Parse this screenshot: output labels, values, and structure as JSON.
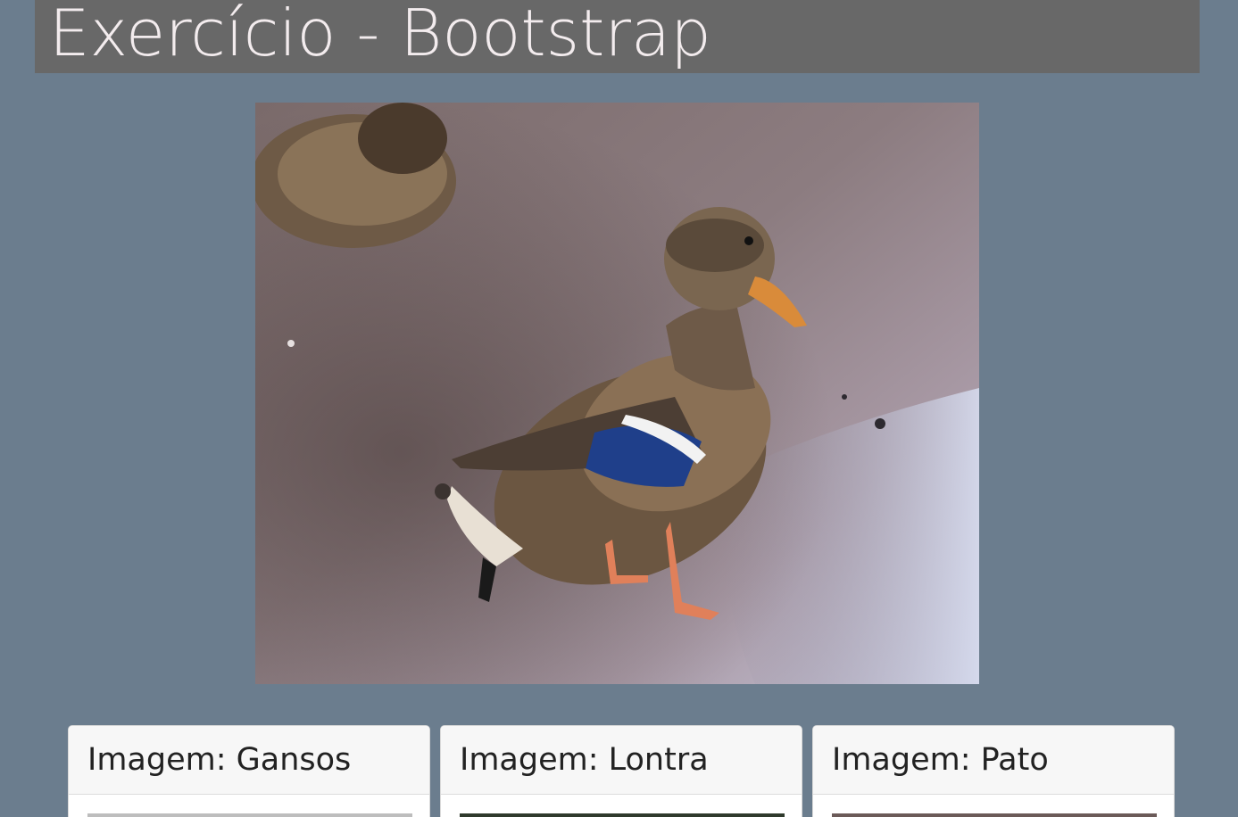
{
  "header": {
    "title": "Exercício - Bootstrap"
  },
  "hero": {
    "image_icon": "duck-photo"
  },
  "cards": [
    {
      "title": "Imagem: Gansos",
      "thumb_color": "#bdbdbd"
    },
    {
      "title": "Imagem: Lontra",
      "thumb_color": "#2f3a2c"
    },
    {
      "title": "Imagem: Pato",
      "thumb_color": "#6b5a58"
    }
  ]
}
